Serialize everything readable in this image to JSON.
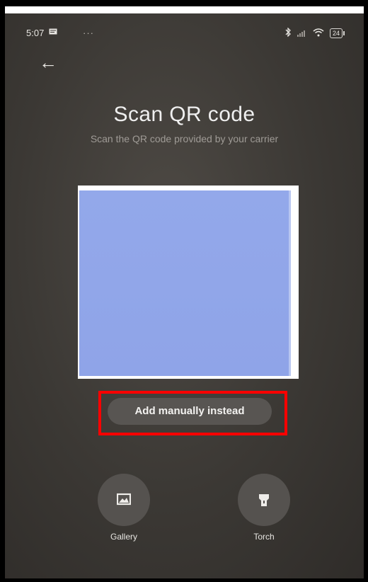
{
  "status_bar": {
    "time": "5:07",
    "message_icon": "message-icon",
    "dots": "···",
    "battery": "24",
    "icons": [
      "bluetooth-icon",
      "signal-icon",
      "wifi-icon",
      "battery-icon"
    ]
  },
  "header": {
    "back_icon": "back-arrow-icon",
    "back_glyph": "←",
    "title": "Scan QR code",
    "subtitle": "Scan the QR code provided by your carrier"
  },
  "actions": {
    "add_manually_label": "Add manually instead"
  },
  "tools": [
    {
      "label": "Gallery",
      "icon": "gallery-icon"
    },
    {
      "label": "Torch",
      "icon": "torch-icon"
    }
  ],
  "colors": {
    "highlight": "#ff0000",
    "viewfinder": "#8fa4e8",
    "background": "#3b3834"
  }
}
